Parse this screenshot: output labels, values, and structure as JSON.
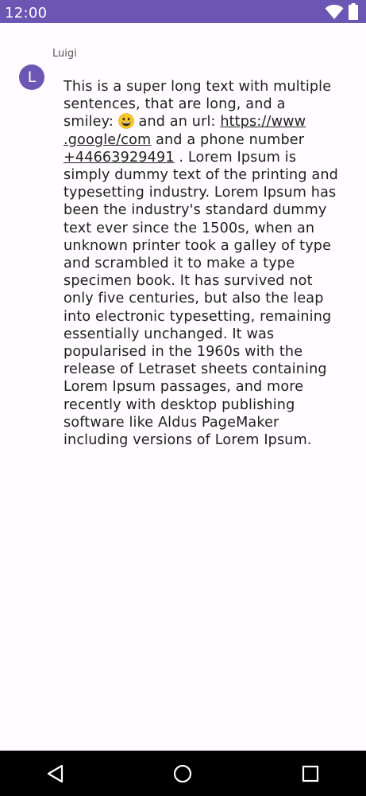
{
  "status_bar": {
    "time": "12:00",
    "icons": [
      "wifi-icon",
      "battery-icon"
    ],
    "background_color": "#6b56b3"
  },
  "message": {
    "sender_name": "Luigi",
    "avatar_initial": "L",
    "avatar_color": "#6b56b3",
    "text_part1": "This is a super long text with multiple sentences, that are long, and a smiley: ",
    "emoji": "grinning-face-emoji",
    "text_part2": " and an url: ",
    "url_line1": "https://www",
    "url_line2": ".google/com",
    "text_part3": " and a phone number ",
    "phone": "+44663929491",
    "text_part4": " . Lorem Ipsum is simply dummy text of the printing and typesetting industry. Lorem Ipsum has been the industry's standard dummy text ever since the 1500s, when an unknown printer took a galley of type and scrambled it to make a type specimen book. It has survived not only five centuries, but also the leap into electronic typesetting, remaining essentially unchanged. It was popularised in the 1960s with the release of Letraset sheets containing Lorem Ipsum passages, and more recently with desktop publishing software like Aldus PageMaker including versions of Lorem Ipsum."
  },
  "nav_bar": {
    "buttons": [
      "back-icon",
      "home-icon",
      "recents-icon"
    ]
  }
}
